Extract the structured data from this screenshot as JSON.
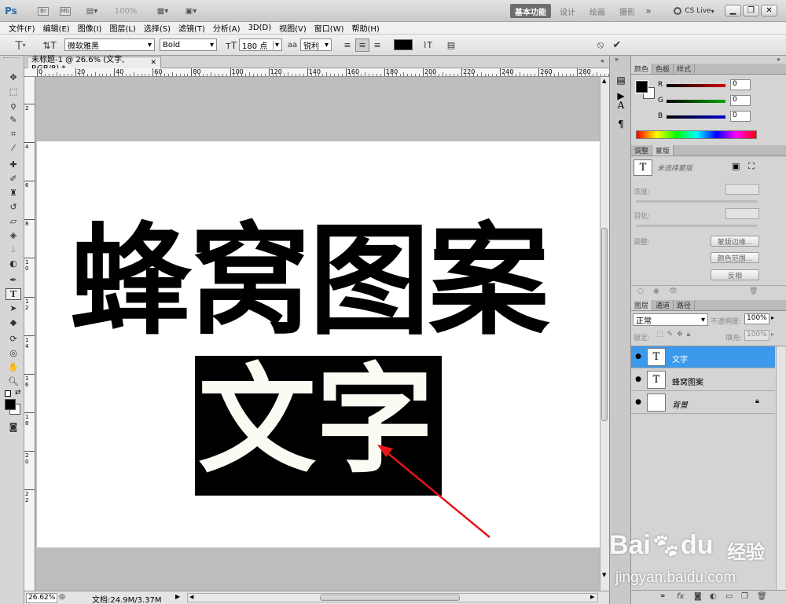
{
  "app": {
    "logo": "Ps",
    "zoom_combo": "100%",
    "workspaces": [
      "基本功能",
      "设计",
      "绘画",
      "摄影"
    ],
    "cs_live": "CS Live"
  },
  "menu": [
    "文件(F)",
    "编辑(E)",
    "图像(I)",
    "图层(L)",
    "选择(S)",
    "滤镜(T)",
    "分析(A)",
    "3D(D)",
    "视图(V)",
    "窗口(W)",
    "帮助(H)"
  ],
  "options": {
    "font_family": "微软雅黑",
    "font_style": "Bold",
    "font_size": "180 点",
    "aa_label": "aa",
    "antialias": "锐利",
    "text_color": "#000000"
  },
  "document": {
    "tab_title": "未标题-1 @ 26.6% (文字, RGB/8) *",
    "headline": "蜂窝图案",
    "subtext": "文字",
    "ruler_h": [
      "0",
      "20",
      "40",
      "60",
      "80",
      "100",
      "120",
      "140",
      "160",
      "180",
      "200",
      "220",
      "240",
      "260",
      "280"
    ],
    "ruler_v": [
      "2",
      "4",
      "6",
      "8",
      "1 0",
      "1 2",
      "1 4",
      "1 6",
      "1 8",
      "2 0",
      "2 2"
    ],
    "arrow_color": "#e8151a"
  },
  "status": {
    "zoom": "26.62%",
    "doc_info": "文档:24.9M/3.37M"
  },
  "color_panel": {
    "tabs": [
      "颜色",
      "色板",
      "样式"
    ],
    "channels": [
      {
        "label": "R",
        "value": "0",
        "color": "#d40000"
      },
      {
        "label": "G",
        "value": "0",
        "color": "#00a800"
      },
      {
        "label": "B",
        "value": "0",
        "color": "#0000d0"
      }
    ]
  },
  "mask_panel": {
    "tabs": [
      "调整",
      "蒙版"
    ],
    "no_mask": "未选择蒙版",
    "density_label": "浓度:",
    "feather_label": "羽化:",
    "refine_label": "调整:",
    "buttons": [
      "蒙版边缘...",
      "颜色范围...",
      "反相"
    ]
  },
  "layers_panel": {
    "tabs": [
      "图层",
      "通道",
      "路径"
    ],
    "blend_mode": "正常",
    "opacity_label": "不透明度:",
    "opacity": "100%",
    "lock_label": "锁定:",
    "fill_label": "填充:",
    "fill": "100%",
    "layers": [
      {
        "name": "文字",
        "type": "T",
        "selected": true
      },
      {
        "name": "蜂窝图案",
        "type": "T",
        "selected": false
      },
      {
        "name": "背景",
        "type": "",
        "selected": false,
        "locked": true
      }
    ]
  },
  "watermark": {
    "brand": "Bai",
    "brand2": "du",
    "cn": "经验",
    "url": "jingyan.baidu.com"
  }
}
